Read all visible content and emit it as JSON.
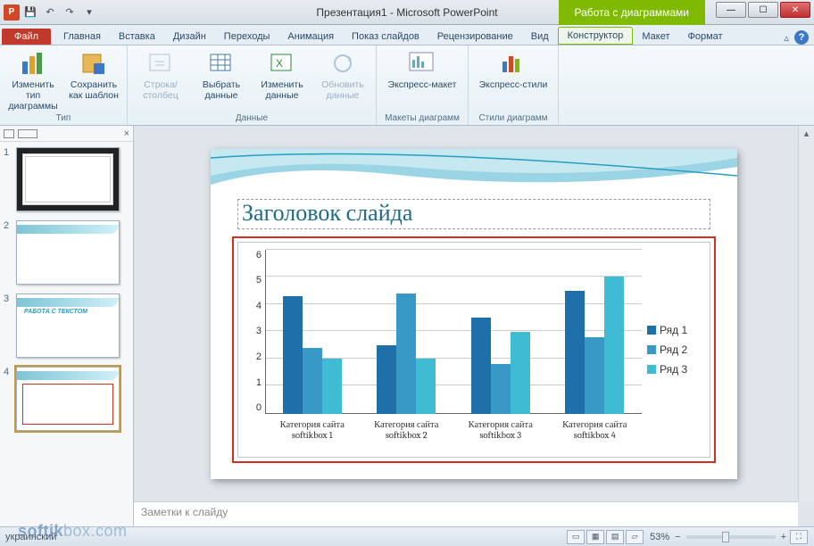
{
  "titlebar": {
    "title": "Презентация1 - Microsoft PowerPoint",
    "chart_tools": "Работа с диаграммами"
  },
  "tabs": {
    "file": "Файл",
    "items": [
      "Главная",
      "Вставка",
      "Дизайн",
      "Переходы",
      "Анимация",
      "Показ слайдов",
      "Рецензирование",
      "Вид"
    ],
    "chart": [
      "Конструктор",
      "Макет",
      "Формат"
    ],
    "active": "Конструктор"
  },
  "ribbon": {
    "type": {
      "label": "Тип",
      "change": "Изменить тип диаграммы",
      "save": "Сохранить как шаблон"
    },
    "data": {
      "label": "Данные",
      "swap": "Строка/столбец",
      "select": "Выбрать данные",
      "edit": "Изменить данные",
      "refresh": "Обновить данные"
    },
    "layouts": {
      "label": "Макеты диаграмм",
      "quick": "Экспресс-макет"
    },
    "styles": {
      "label": "Стили диаграмм",
      "quick": "Экспресс-стили"
    }
  },
  "thumbs": {
    "count": 4,
    "selected": 4
  },
  "slide": {
    "title_placeholder": "Заголовок слайда"
  },
  "chart_data": {
    "type": "bar",
    "categories": [
      "Категория сайта softikbox 1",
      "Категория сайта softikbox 2",
      "Категория сайта softikbox 3",
      "Категория сайта softikbox 4"
    ],
    "series": [
      {
        "name": "Ряд 1",
        "color": "#1f6fa8",
        "values": [
          4.3,
          2.5,
          3.5,
          4.5
        ]
      },
      {
        "name": "Ряд 2",
        "color": "#3899c6",
        "values": [
          2.4,
          4.4,
          1.8,
          2.8
        ]
      },
      {
        "name": "Ряд 3",
        "color": "#3fbcd4",
        "values": [
          2.0,
          2.0,
          3.0,
          5.0
        ]
      }
    ],
    "ylim": [
      0,
      6
    ],
    "yticks": [
      0,
      1,
      2,
      3,
      4,
      5,
      6
    ]
  },
  "legend_title": {
    "r1": "Ряд 1",
    "r2": "Ряд 2",
    "r3": "Ряд 3"
  },
  "notes": {
    "placeholder": "Заметки к слайду"
  },
  "status": {
    "lang": "украинский",
    "zoom": "53%"
  },
  "watermark": "softikbox.com"
}
